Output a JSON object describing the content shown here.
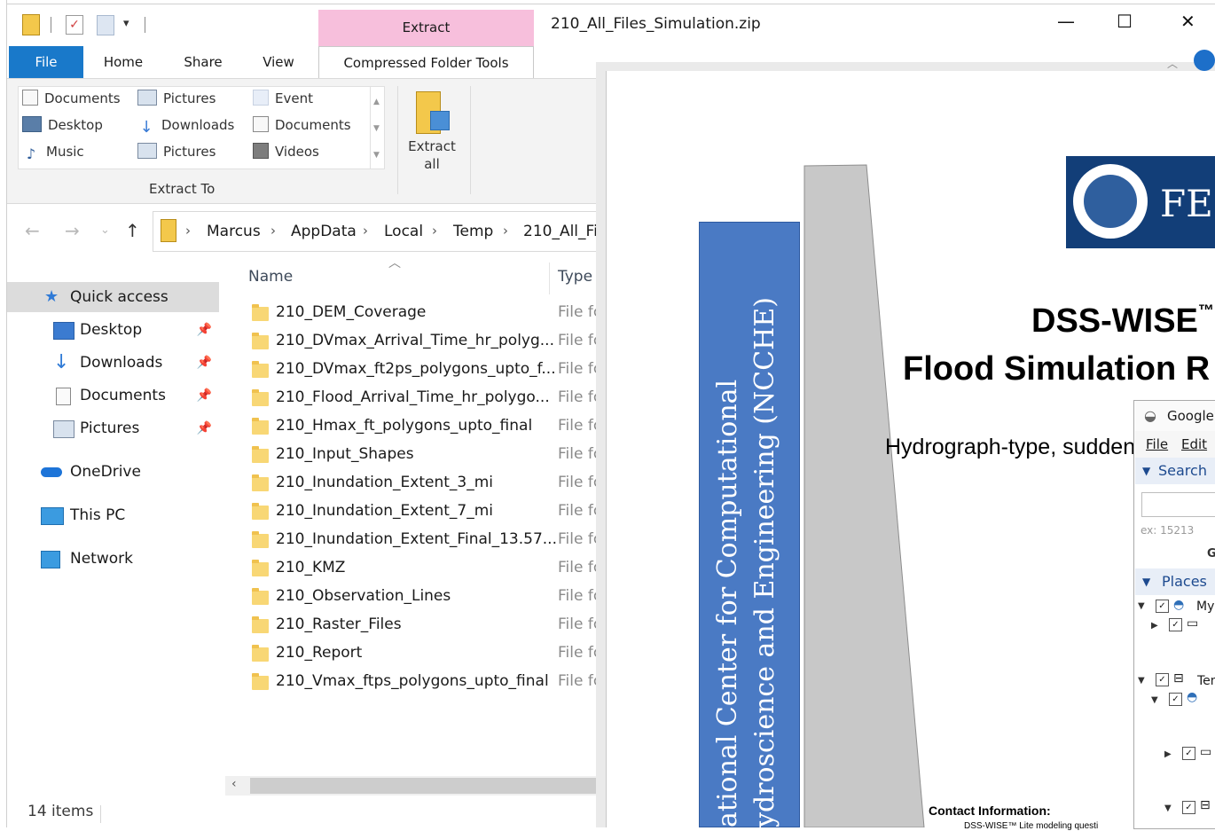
{
  "window": {
    "title": "210_All_Files_Simulation.zip",
    "contextual_tab_group": "Extract",
    "controls": {
      "minimize": "—",
      "maximize": "☐",
      "close": "✕"
    }
  },
  "ribbon": {
    "tabs": [
      "File",
      "Home",
      "Share",
      "View",
      "Compressed Folder Tools"
    ],
    "gallery": [
      {
        "label": "Documents",
        "icon": "documents-icon"
      },
      {
        "label": "Pictures",
        "icon": "pictures-icon"
      },
      {
        "label": "Event",
        "icon": "folder-icon"
      },
      {
        "label": "Desktop",
        "icon": "desktop-icon"
      },
      {
        "label": "Downloads",
        "icon": "downloads-icon"
      },
      {
        "label": "Documents",
        "icon": "documents-icon"
      },
      {
        "label": "Music",
        "icon": "music-icon"
      },
      {
        "label": "Pictures",
        "icon": "pictures-icon"
      },
      {
        "label": "Videos",
        "icon": "videos-icon"
      }
    ],
    "group_label": "Extract To",
    "extract_all": "Extract\nall"
  },
  "address": {
    "breadcrumbs": [
      "Marcus",
      "AppData",
      "Local",
      "Temp",
      "210_All_Fil"
    ]
  },
  "nav": {
    "quick_access": "Quick access",
    "pinned": [
      {
        "label": "Desktop",
        "icon": "desktop-icon"
      },
      {
        "label": "Downloads",
        "icon": "downloads-icon"
      },
      {
        "label": "Documents",
        "icon": "documents-icon"
      },
      {
        "label": "Pictures",
        "icon": "pictures-icon"
      }
    ],
    "onedrive": "OneDrive",
    "this_pc": "This PC",
    "network": "Network"
  },
  "files": {
    "columns": {
      "name": "Name",
      "type": "Type"
    },
    "rows": [
      {
        "name": "210_DEM_Coverage",
        "type": "File fc"
      },
      {
        "name": "210_DVmax_Arrival_Time_hr_polyg...",
        "type": "File fc"
      },
      {
        "name": "210_DVmax_ft2ps_polygons_upto_f...",
        "type": "File fc"
      },
      {
        "name": "210_Flood_Arrival_Time_hr_polygo...",
        "type": "File fc"
      },
      {
        "name": "210_Hmax_ft_polygons_upto_final",
        "type": "File fc"
      },
      {
        "name": "210_Input_Shapes",
        "type": "File fc"
      },
      {
        "name": "210_Inundation_Extent_3_mi",
        "type": "File fc"
      },
      {
        "name": "210_Inundation_Extent_7_mi",
        "type": "File fc"
      },
      {
        "name": "210_Inundation_Extent_Final_13.57...",
        "type": "File fc"
      },
      {
        "name": "210_KMZ",
        "type": "File fc"
      },
      {
        "name": "210_Observation_Lines",
        "type": "File fc"
      },
      {
        "name": "210_Raster_Files",
        "type": "File fc"
      },
      {
        "name": "210_Report",
        "type": "File fc"
      },
      {
        "name": "210_Vmax_ftps_polygons_upto_final",
        "type": "File fc"
      }
    ],
    "status": "14 items"
  },
  "document": {
    "band_line1": "ational Center for Computational",
    "band_line2": "ydroscience and Engineering (NCCHE)",
    "logo_text": "FE",
    "title1": "DSS-WISE",
    "title2": "Flood Simulation R",
    "subtitle": "Hydrograph-type, sudden",
    "contact": "Contact Information:",
    "contact_line": "DSS-WISE™ Lite modeling questi"
  },
  "google_earth": {
    "title": "Google",
    "menu": [
      "File",
      "Edit"
    ],
    "search": "Search",
    "example": "ex: 15213",
    "places": "Places",
    "places_items": [
      "My",
      "Ten"
    ]
  }
}
